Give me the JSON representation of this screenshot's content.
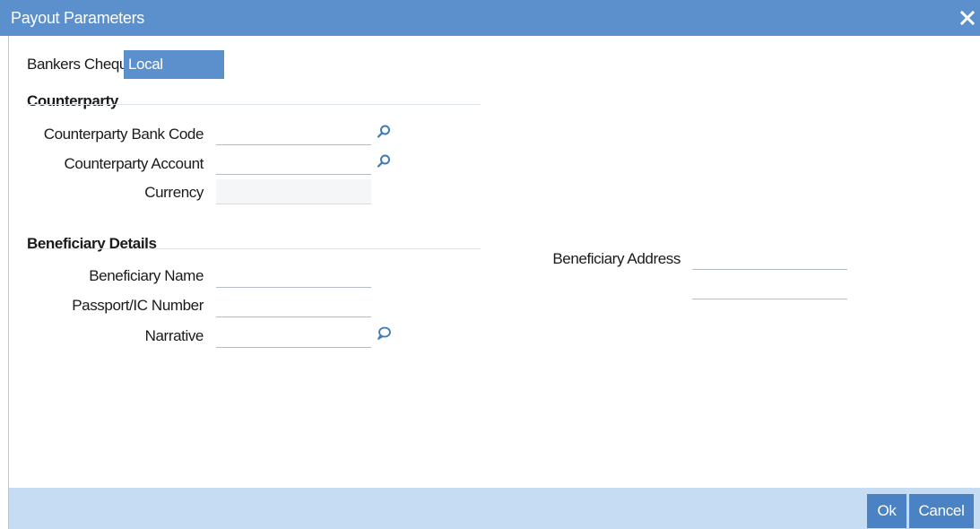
{
  "window": {
    "title": "Payout Parameters",
    "close_icon": "close-icon"
  },
  "tabs": [
    {
      "label": "Bankers Cheque",
      "active": false
    },
    {
      "label": "Local Payments",
      "active": true
    }
  ],
  "counterparty": {
    "section_title": "Counterparty",
    "bank_code": {
      "label": "Counterparty Bank Code",
      "value": "",
      "icon": "search-icon"
    },
    "account": {
      "label": "Counterparty Account",
      "value": "",
      "icon": "search-icon"
    },
    "currency": {
      "label": "Currency",
      "value": ""
    }
  },
  "beneficiary": {
    "section_title": "Beneficiary Details",
    "name": {
      "label": "Beneficiary Name",
      "value": ""
    },
    "passport": {
      "label": "Passport/IC Number",
      "value": ""
    },
    "narrative": {
      "label": "Narrative",
      "value": "",
      "icon": "comment-icon"
    },
    "address": {
      "label": "Beneficiary Address",
      "line1": "",
      "line2": ""
    }
  },
  "footer": {
    "ok_label": "Ok",
    "cancel_label": "Cancel"
  },
  "colors": {
    "accent": "#5b90cc",
    "button": "#4a82c4",
    "footer_bg": "#c5dcf3",
    "icon": "#3d7ab8"
  }
}
